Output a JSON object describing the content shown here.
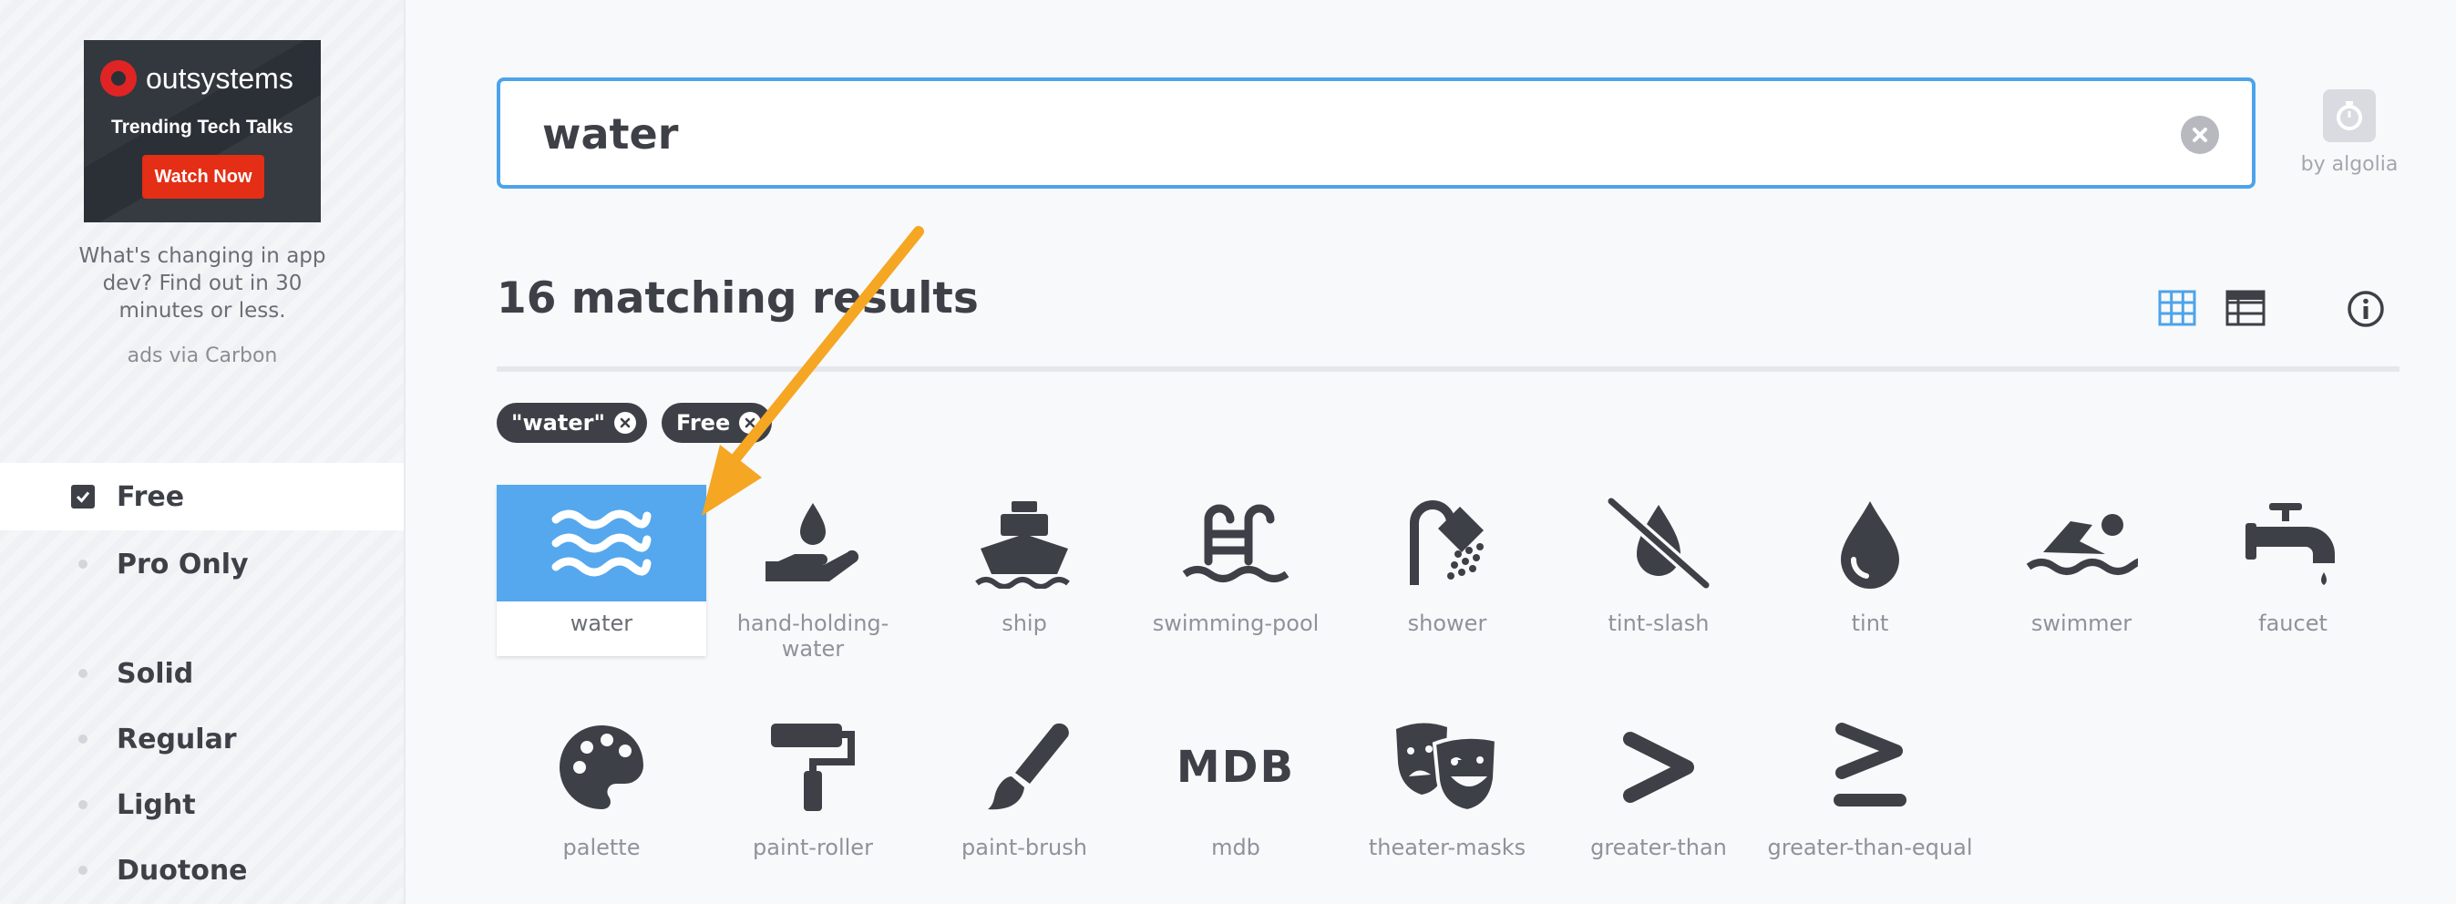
{
  "ad": {
    "brand": "outsystems",
    "tagline": "Trending Tech Talks",
    "cta": "Watch Now",
    "text": "What's changing in app dev? Find out in 30 minutes or less.",
    "via": "ads via Carbon"
  },
  "filters": [
    {
      "label": "Free",
      "checked": true
    },
    {
      "label": "Pro Only",
      "checked": false
    },
    {
      "label": "Solid",
      "checked": false
    },
    {
      "label": "Regular",
      "checked": false
    },
    {
      "label": "Light",
      "checked": false
    },
    {
      "label": "Duotone",
      "checked": false
    }
  ],
  "search": {
    "value": "water"
  },
  "algolia": {
    "label": "by algolia"
  },
  "results": {
    "count_text": "16 matching results"
  },
  "chips": [
    {
      "label": "\"water\""
    },
    {
      "label": "Free"
    }
  ],
  "icons": [
    {
      "name": "water",
      "icon": "water-icon",
      "selected": true
    },
    {
      "name": "hand-holding-water",
      "icon": "hand-holding-water-icon"
    },
    {
      "name": "ship",
      "icon": "ship-icon"
    },
    {
      "name": "swimming-pool",
      "icon": "swimming-pool-icon"
    },
    {
      "name": "shower",
      "icon": "shower-icon"
    },
    {
      "name": "tint-slash",
      "icon": "tint-slash-icon"
    },
    {
      "name": "tint",
      "icon": "tint-icon"
    },
    {
      "name": "swimmer",
      "icon": "swimmer-icon"
    },
    {
      "name": "faucet",
      "icon": "faucet-icon"
    },
    {
      "name": "palette",
      "icon": "palette-icon"
    },
    {
      "name": "paint-roller",
      "icon": "paint-roller-icon"
    },
    {
      "name": "paint-brush",
      "icon": "paint-brush-icon"
    },
    {
      "name": "mdb",
      "icon": "mdb-icon",
      "glyph_text": "MDB"
    },
    {
      "name": "theater-masks",
      "icon": "theater-masks-icon"
    },
    {
      "name": "greater-than",
      "icon": "greater-than-icon"
    },
    {
      "name": "greater-than-equal",
      "icon": "greater-than-equal-icon"
    }
  ],
  "colors": {
    "accent": "#4da3ea",
    "selected_tile": "#55a8ee",
    "icon": "#3e4047",
    "arrow": "#f5a623",
    "ad_button": "#e42e16"
  }
}
